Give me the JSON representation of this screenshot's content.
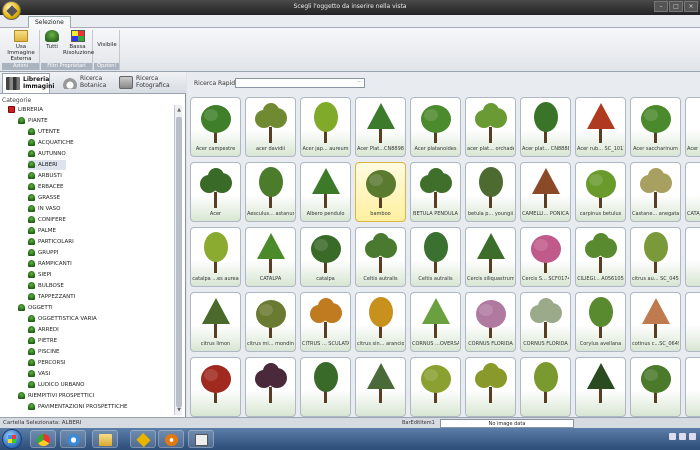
{
  "window": {
    "title": "Scegli l'oggetto da inserire nella vista"
  },
  "ribbon": {
    "tab": "Selezione",
    "groups": [
      {
        "title": "Azioni",
        "buttons": [
          "Usa Immagine Esterna"
        ]
      },
      {
        "title": "Filtri Proprietari",
        "buttons": [
          "Tutti",
          "Bassa Risoluzione"
        ]
      },
      {
        "title": "Opzioni",
        "buttons": [
          "Visibile"
        ]
      }
    ]
  },
  "left_panel": {
    "tabs": [
      {
        "label": "Libreria Immagini",
        "icon": "books-icon"
      },
      {
        "label": "Ricerca Botanica",
        "icon": "lotus-icon"
      },
      {
        "label": "Ricerca Fotografica",
        "icon": "photo-icon"
      }
    ],
    "categories_label": "Categorie",
    "tree": [
      {
        "label": "LIBRERIA",
        "level": 0,
        "icon": "red"
      },
      {
        "label": "PIANTE",
        "level": 1
      },
      {
        "label": "UTENTE",
        "level": 2
      },
      {
        "label": "ACQUATICHE",
        "level": 2
      },
      {
        "label": "AUTUNNO",
        "level": 2
      },
      {
        "label": "ALBERI",
        "level": 2,
        "selected": true
      },
      {
        "label": "ARBUSTI",
        "level": 2
      },
      {
        "label": "ERBACEE",
        "level": 2
      },
      {
        "label": "GRASSE",
        "level": 2
      },
      {
        "label": "IN VASO",
        "level": 2
      },
      {
        "label": "CONIFERE",
        "level": 2
      },
      {
        "label": "PALME",
        "level": 2
      },
      {
        "label": "PARTICOLARI",
        "level": 2
      },
      {
        "label": "GRUPPI",
        "level": 2
      },
      {
        "label": "RAMPICANTI",
        "level": 2
      },
      {
        "label": "SIEPI",
        "level": 2
      },
      {
        "label": "BULBOSE",
        "level": 2
      },
      {
        "label": "TAPPEZZANTI",
        "level": 2
      },
      {
        "label": "OGGETTI",
        "level": 1
      },
      {
        "label": "OGGETTISTICA VARIA",
        "level": 2
      },
      {
        "label": "ARREDI",
        "level": 2
      },
      {
        "label": "PIETRE",
        "level": 2
      },
      {
        "label": "PISCINE",
        "level": 2
      },
      {
        "label": "PERCORSI",
        "level": 2
      },
      {
        "label": "VASI",
        "level": 2
      },
      {
        "label": "LUDICO URBANO",
        "level": 2
      },
      {
        "label": "RIEMPITIVI PROSPETTICI",
        "level": 1
      },
      {
        "label": "PAVIMENTAZIONI PROSPETTICHE",
        "level": 2
      }
    ]
  },
  "search": {
    "label": "Ricerca Rapida",
    "value": "",
    "button": "···"
  },
  "grid": {
    "rows": [
      [
        {
          "label": "Acer campestre",
          "color": "#3f7f2a"
        },
        {
          "label": "acer davidii",
          "color": "#6f8a30"
        },
        {
          "label": "Acer jap... aureum",
          "color": "#7faa2a"
        },
        {
          "label": "Acer Plat...CN8898",
          "color": "#3d7a2c"
        },
        {
          "label": "Acer platanoides",
          "color": "#4c8a2e"
        },
        {
          "label": "acer plat... orchade",
          "color": "#6a9a34"
        },
        {
          "label": "Acer plat... CN8888",
          "color": "#3a7428"
        },
        {
          "label": "Acer rub... SC_1017",
          "color": "#b03a20"
        },
        {
          "label": "Acer saccharinum",
          "color": "#4a8a2c"
        }
      ],
      [
        {
          "label": "Acer",
          "color": "#3a6a28"
        },
        {
          "label": "Aesculus... astanum",
          "color": "#4a7c2c"
        },
        {
          "label": "Albero pendulo",
          "color": "#3c7a2a"
        },
        {
          "label": "bamboo",
          "color": "#5a7a30",
          "highlight": true
        },
        {
          "label": "BETULA PENDULA",
          "color": "#3f6f2a"
        },
        {
          "label": "betula p... youngii",
          "color": "#4d6a30"
        },
        {
          "label": "CAMELLI... PONICA",
          "color": "#8a4a28"
        },
        {
          "label": "carpinus betulus",
          "color": "#6a9a2c"
        },
        {
          "label": "Castane... anegata",
          "color": "#a8a060"
        }
      ],
      [
        {
          "label": "catalpa ...es aurea",
          "color": "#8aaa30"
        },
        {
          "label": "CATALPA",
          "color": "#4a8a28"
        },
        {
          "label": "catalpa",
          "color": "#3a6a28"
        },
        {
          "label": "Celtis autralis",
          "color": "#4a7a30"
        },
        {
          "label": "Celtis autralis",
          "color": "#3a7030"
        },
        {
          "label": "Cercis siliquastrum",
          "color": "#3d6d2a"
        },
        {
          "label": "Cercis S... SCF0174",
          "color": "#c05a8a"
        },
        {
          "label": "CILIEGI... A056105",
          "color": "#5a8a30"
        },
        {
          "label": "citrus au... SC_0457",
          "color": "#7a9a3a"
        }
      ],
      [
        {
          "label": "citrus limon",
          "color": "#4a6a2c"
        },
        {
          "label": "citrus mi... mondino",
          "color": "#6a7a30"
        },
        {
          "label": "CITRUS ... SCULATA",
          "color": "#c07a20"
        },
        {
          "label": "citrus sin... arancio",
          "color": "#c8901c"
        },
        {
          "label": "CORNUS ...OVERSA",
          "color": "#6aa040"
        },
        {
          "label": "CORNUS FLORIDA",
          "color": "#b07aa0"
        },
        {
          "label": "CORNUS FLORIDA",
          "color": "#9aaa8a"
        },
        {
          "label": "Corylus avellana",
          "color": "#5a8a30"
        },
        {
          "label": "cotinus c...SC_0649",
          "color": "#c07a50"
        }
      ],
      [
        {
          "label": "",
          "color": "#a02a20"
        },
        {
          "label": "",
          "color": "#4a2a3a"
        },
        {
          "label": "",
          "color": "#3a6a2a"
        },
        {
          "label": "",
          "color": "#4a6a3a"
        },
        {
          "label": "",
          "color": "#8aa030"
        },
        {
          "label": "",
          "color": "#8a9a2a"
        },
        {
          "label": "",
          "color": "#7a9a30"
        },
        {
          "label": "",
          "color": "#2a4a20"
        },
        {
          "label": "",
          "color": "#4a7a2a"
        }
      ]
    ],
    "partial_column": [
      {
        "label": "Acer"
      },
      {
        "label": "CATA"
      },
      {
        "label": ""
      },
      {
        "label": ""
      },
      {
        "label": ""
      }
    ]
  },
  "statusbar": {
    "text": "Cartella Selezionata: ALBERI",
    "bar_label": "BarEditItem1",
    "image_box": "No image data"
  },
  "taskbar": {
    "items": [
      "windows-explorer-icon",
      "chrome-icon",
      "ie-icon",
      "explorer-folder-icon",
      "app-icon",
      "media-player-icon",
      "window-icon"
    ]
  }
}
